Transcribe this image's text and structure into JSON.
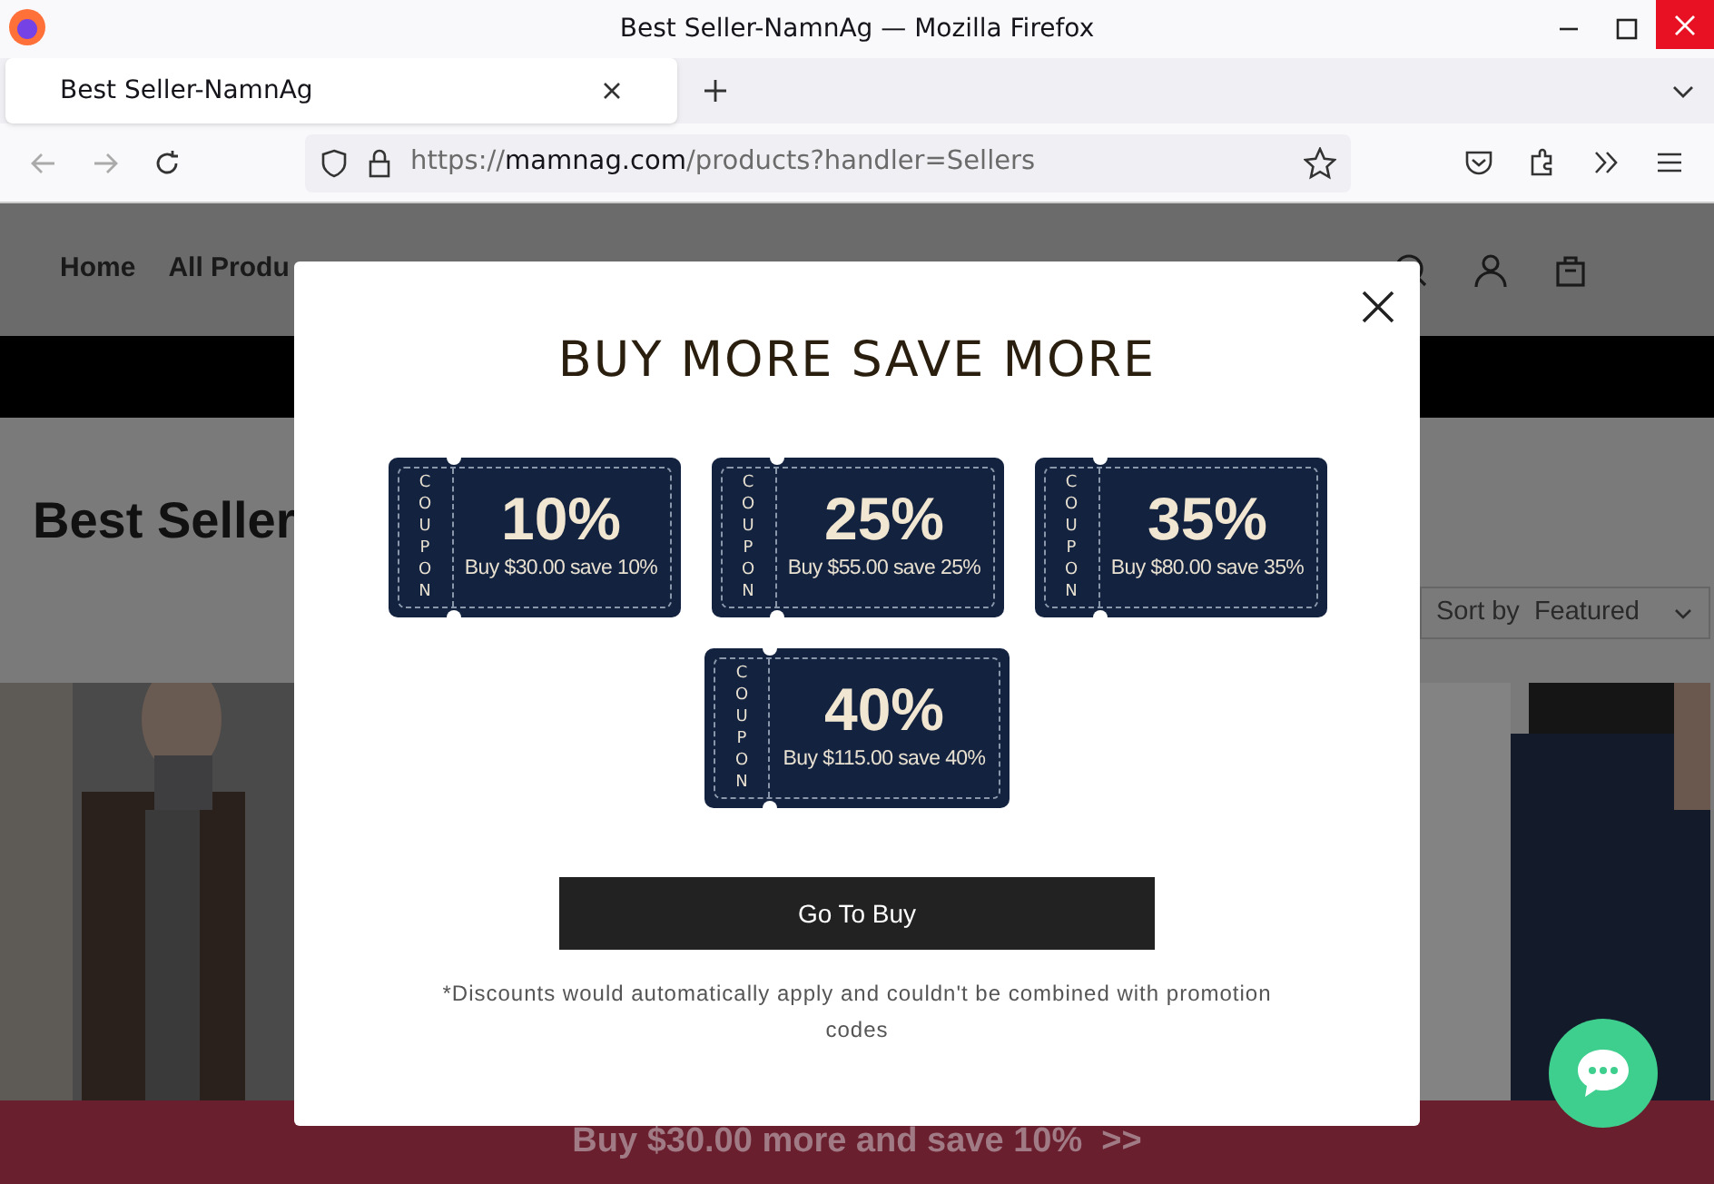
{
  "window": {
    "title": "Best Seller-NamnAg — Mozilla Firefox"
  },
  "tabs": [
    {
      "label": "Best Seller-NamnAg",
      "selected": true
    }
  ],
  "address_bar": {
    "scheme": "https://",
    "domain": "mamnag.com",
    "path": "/products?handler=Sellers"
  },
  "site": {
    "nav": [
      "Home",
      "All Produ"
    ],
    "heading": "Best Seller",
    "sort": {
      "label": "Sort by",
      "value": "Featured"
    },
    "promo_bar": "Buy $30.00 more and save 10%  >>"
  },
  "popup": {
    "title": "BUY MORE SAVE MORE",
    "coupons": [
      {
        "tag": "COUPON",
        "percent": "10%",
        "caption": "Buy $30.00 save 10%"
      },
      {
        "tag": "COUPON",
        "percent": "25%",
        "caption": "Buy $55.00 save 25%"
      },
      {
        "tag": "COUPON",
        "percent": "35%",
        "caption": "Buy $80.00 save 35%"
      },
      {
        "tag": "COUPON",
        "percent": "40%",
        "caption": "Buy $115.00 save 40%"
      }
    ],
    "button": "Go To Buy",
    "note": "*Discounts would automatically apply and couldn't be combined with promotion codes"
  }
}
